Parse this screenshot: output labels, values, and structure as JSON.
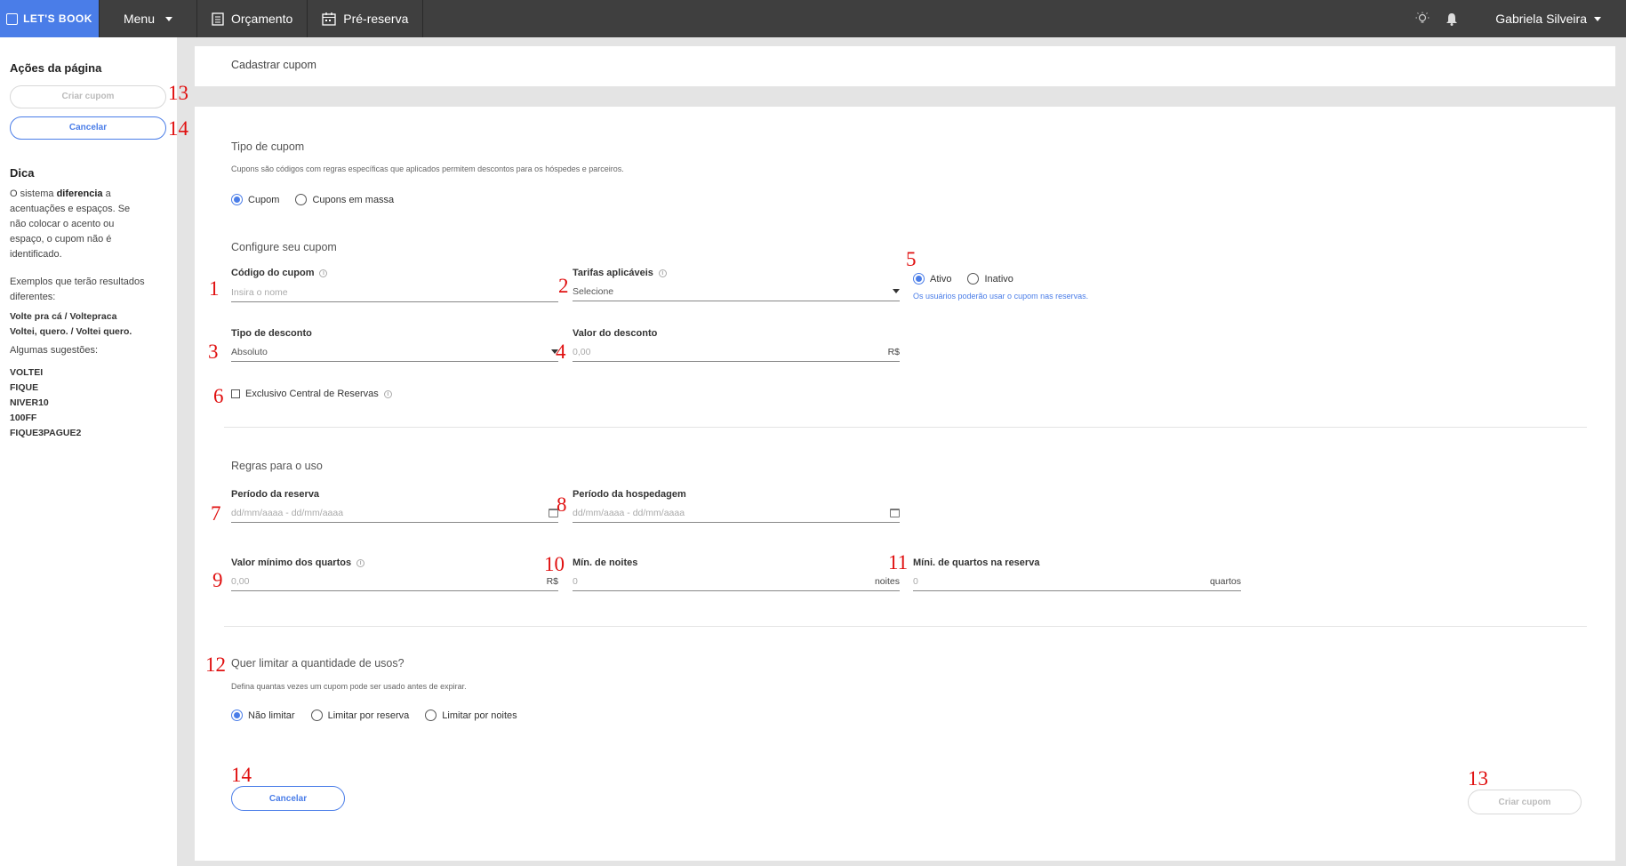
{
  "topbar": {
    "brand": "LET'S BOOK",
    "menu": "Menu",
    "orcamento": "Orçamento",
    "pre_reserva": "Pré-reserva",
    "user": "Gabriela Silveira"
  },
  "sidebar": {
    "title": "Ações da página",
    "create_btn": "Criar cupom",
    "cancel_btn": "Cancelar",
    "tip_title": "Dica",
    "tip_pre": "O sistema ",
    "tip_bold": "diferencia",
    "tip_post": " a acentuações e espaços. Se não colocar o acento ou espaço, o cupom não é identificado.",
    "examples_intro": "Exemplos que terão resultados diferentes:",
    "example_1": "Volte pra cá / Voltepraca",
    "example_2": "Voltei, quero. / Voltei quero.",
    "suggestions_intro": "Algumas sugestões:",
    "suggestions": [
      "VOLTEI",
      "FIQUE",
      "NIVER10",
      "100FF",
      "FIQUE3PAGUE2"
    ]
  },
  "header": {
    "title": "Cadastrar cupom"
  },
  "tipo_cupom": {
    "title": "Tipo de cupom",
    "desc": "Cupons são códigos com regras específicas que aplicados permitem descontos para os hóspedes e parceiros.",
    "opt_cupom": "Cupom",
    "opt_massa": "Cupons em massa",
    "selected": "Cupom"
  },
  "config": {
    "title": "Configure seu cupom",
    "codigo_label": "Código do cupom",
    "codigo_placeholder": "Insira o nome",
    "tarifas_label": "Tarifas aplicáveis",
    "tarifas_value": "Selecione",
    "status_ativo": "Ativo",
    "status_inativo": "Inativo",
    "status_selected": "Ativo",
    "status_hint": "Os usuários poderão usar o cupom nas reservas.",
    "tipo_desc_label": "Tipo de desconto",
    "tipo_desc_value": "Absoluto",
    "valor_desc_label": "Valor do desconto",
    "valor_desc_placeholder": "0,00",
    "currency": "R$",
    "exclusivo_label": "Exclusivo Central de Reservas",
    "exclusivo_checked": false
  },
  "regras": {
    "title": "Regras para o uso",
    "periodo_reserva_label": "Período da reserva",
    "periodo_hospedagem_label": "Período da hospedagem",
    "date_placeholder": "dd/mm/aaaa - dd/mm/aaaa",
    "valor_min_label": "Valor mínimo dos quartos",
    "valor_min_placeholder": "0,00",
    "min_noites_label": "Mín. de noites",
    "min_noites_value": "0",
    "noites_suffix": "noites",
    "min_quartos_label": "Míni. de quartos na reserva",
    "min_quartos_value": "0",
    "quartos_suffix": "quartos"
  },
  "limite": {
    "title": "Quer limitar a quantidade de usos?",
    "desc": "Defina quantas vezes um cupom pode ser usado antes de expirar.",
    "opt_nao": "Não limitar",
    "opt_reserva": "Limitar por reserva",
    "opt_noites": "Limitar por noites",
    "selected": "Não limitar"
  },
  "footer": {
    "cancel": "Cancelar",
    "create": "Criar cupom"
  },
  "markers": [
    "1",
    "2",
    "3",
    "4",
    "5",
    "6",
    "7",
    "8",
    "9",
    "10",
    "11",
    "12",
    "13",
    "14"
  ],
  "colors": {
    "accent": "#4a7de8",
    "topbar": "#3f3f3f",
    "marker": "#e01010"
  }
}
